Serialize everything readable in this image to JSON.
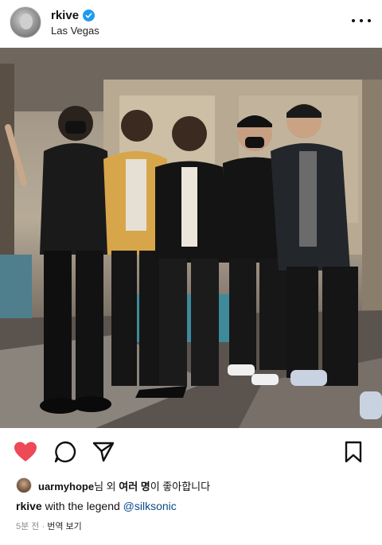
{
  "header": {
    "username": "rkive",
    "location": "Las Vegas"
  },
  "likes": {
    "liker": "uarmyhope",
    "suffix_1": "님 외 ",
    "bold_part": "여러 명",
    "suffix_2": "이 좋아합니다"
  },
  "caption": {
    "username": "rkive",
    "text": " with the legend ",
    "tag": "@silksonic"
  },
  "meta": {
    "time": "5분 전",
    "separator": " · ",
    "translate": "번역 보기"
  },
  "colors": {
    "heart": "#ed4956",
    "verified": "#1d9bf0",
    "tag_link": "#0a4a8a"
  },
  "icons": [
    "more-icon",
    "heart-icon",
    "comment-icon",
    "share-icon",
    "bookmark-icon",
    "verified-badge-icon"
  ]
}
